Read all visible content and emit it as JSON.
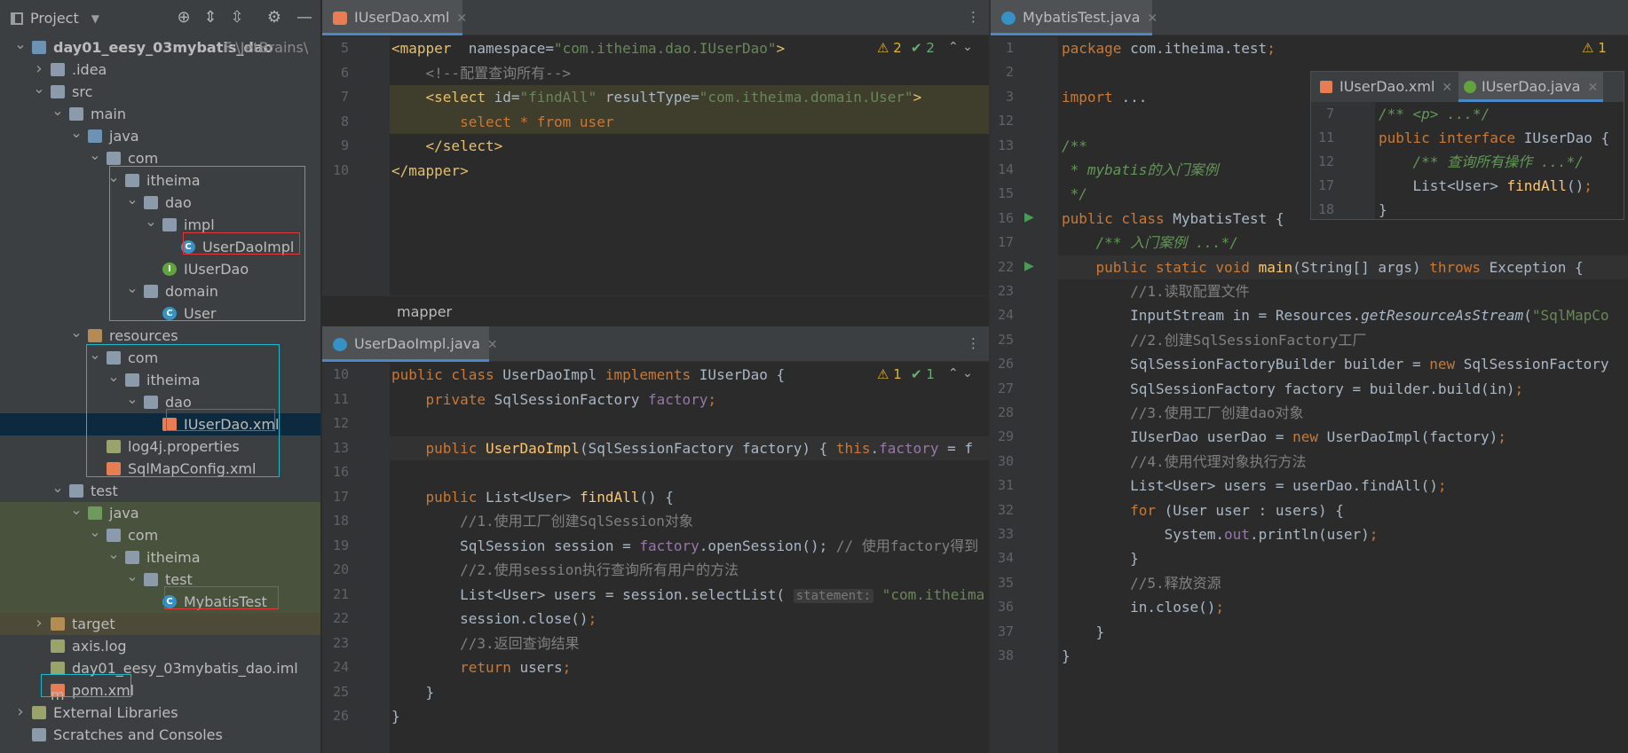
{
  "project_panel": {
    "title": "Project",
    "tree": [
      {
        "label": "day01_eesy_03mybatis_dao",
        "path": "F:\\JetBrains\\"
      },
      {
        "label": ".idea"
      },
      {
        "label": "src"
      },
      {
        "label": "main"
      },
      {
        "label": "java"
      },
      {
        "label": "com"
      },
      {
        "label": "itheima"
      },
      {
        "label": "dao"
      },
      {
        "label": "impl"
      },
      {
        "label": "UserDaoImpl"
      },
      {
        "label": "IUserDao"
      },
      {
        "label": "domain"
      },
      {
        "label": "User"
      },
      {
        "label": "resources"
      },
      {
        "label": "com"
      },
      {
        "label": "itheima"
      },
      {
        "label": "dao"
      },
      {
        "label": "IUserDao.xml"
      },
      {
        "label": "log4j.properties"
      },
      {
        "label": "SqlMapConfig.xml"
      },
      {
        "label": "test"
      },
      {
        "label": "java"
      },
      {
        "label": "com"
      },
      {
        "label": "itheima"
      },
      {
        "label": "test"
      },
      {
        "label": "MybatisTest"
      },
      {
        "label": "target"
      },
      {
        "label": "axis.log"
      },
      {
        "label": "day01_eesy_03mybatis_dao.iml"
      },
      {
        "label": "pom.xml"
      },
      {
        "label": "External Libraries"
      },
      {
        "label": "Scratches and Consoles"
      }
    ]
  },
  "editor_xml": {
    "tab": "IUserDao.xml",
    "breadcrumb": "mapper",
    "warnings": "2",
    "checks": "2",
    "lines": [
      {
        "n": "5",
        "segs": [
          [
            "tg",
            "<mapper"
          ],
          [
            "",
            "  namespace="
          ],
          [
            "str",
            "\"com.itheima.dao.IUserDao\""
          ],
          [
            "tg",
            ">"
          ]
        ]
      },
      {
        "n": "6",
        "segs": [
          [
            "cm",
            "    <!--配置查询所有-->"
          ]
        ]
      },
      {
        "n": "7",
        "segs": [
          [
            "tg",
            "    <select"
          ],
          [
            "",
            " id="
          ],
          [
            "str",
            "\"findAll\""
          ],
          [
            "",
            " resultType="
          ],
          [
            "str",
            "\"com.itheima.domain.User\""
          ],
          [
            "tg",
            ">"
          ]
        ]
      },
      {
        "n": "8",
        "segs": [
          [
            "kw",
            "        select * from user"
          ]
        ]
      },
      {
        "n": "9",
        "segs": [
          [
            "tg",
            "    </select>"
          ]
        ]
      },
      {
        "n": "10",
        "segs": [
          [
            "tg",
            "</mapper>"
          ]
        ]
      }
    ]
  },
  "editor_impl": {
    "tab": "UserDaoImpl.java",
    "warnings": "1",
    "checks": "1",
    "lines": [
      {
        "n": "10",
        "segs": [
          [
            "kw",
            "public class "
          ],
          [
            "",
            "UserDaoImpl "
          ],
          [
            "kw",
            "implements "
          ],
          [
            "",
            "IUserDao {"
          ]
        ]
      },
      {
        "n": "11",
        "segs": [
          [
            "kw",
            "    private "
          ],
          [
            "",
            "SqlSessionFactory "
          ],
          [
            "fld",
            "factory"
          ],
          [
            "kw",
            ";"
          ]
        ]
      },
      {
        "n": "12",
        "segs": [
          [
            "",
            ""
          ]
        ]
      },
      {
        "n": "13",
        "segs": [
          [
            "kw",
            "    public "
          ],
          [
            "fn",
            "UserDaoImpl"
          ],
          [
            "",
            "(SqlSessionFactory factory) { "
          ],
          [
            "kw",
            "this"
          ],
          [
            "",
            "."
          ],
          [
            "fld",
            "factory"
          ],
          [
            "",
            " = f"
          ]
        ]
      },
      {
        "n": "16",
        "segs": [
          [
            "",
            ""
          ]
        ]
      },
      {
        "n": "17",
        "segs": [
          [
            "kw",
            "    public "
          ],
          [
            "",
            "List<User> "
          ],
          [
            "fn",
            "findAll"
          ],
          [
            "",
            "() {"
          ]
        ]
      },
      {
        "n": "18",
        "segs": [
          [
            "cm",
            "        //1.使用工厂创建SqlSession对象"
          ]
        ]
      },
      {
        "n": "19",
        "segs": [
          [
            "",
            "        SqlSession session = "
          ],
          [
            "fld",
            "factory"
          ],
          [
            "",
            ".openSession(); "
          ],
          [
            "cm",
            "// 使用factory得到"
          ]
        ]
      },
      {
        "n": "20",
        "segs": [
          [
            "cm",
            "        //2.使用session执行查询所有用户的方法"
          ]
        ]
      },
      {
        "n": "21",
        "segs": [
          [
            "",
            "        List<User> users = session.selectList( "
          ],
          [
            "hint",
            "statement:"
          ],
          [
            "str",
            " \"com.itheima"
          ]
        ]
      },
      {
        "n": "22",
        "segs": [
          [
            "",
            "        session.close()"
          ],
          [
            "kw",
            ";"
          ]
        ]
      },
      {
        "n": "23",
        "segs": [
          [
            "cm",
            "        //3.返回查询结果"
          ]
        ]
      },
      {
        "n": "24",
        "segs": [
          [
            "kw",
            "        return "
          ],
          [
            "",
            "users"
          ],
          [
            "kw",
            ";"
          ]
        ]
      },
      {
        "n": "25",
        "segs": [
          [
            "",
            "    }"
          ]
        ]
      },
      {
        "n": "26",
        "segs": [
          [
            "",
            "}"
          ]
        ]
      }
    ]
  },
  "editor_test": {
    "tab": "MybatisTest.java",
    "warnings": "1",
    "lines": [
      {
        "n": "1",
        "segs": [
          [
            "kw",
            "package "
          ],
          [
            "",
            "com.itheima.test"
          ],
          [
            "kw",
            ";"
          ]
        ]
      },
      {
        "n": "2",
        "segs": [
          [
            "",
            ""
          ]
        ]
      },
      {
        "n": "3",
        "segs": [
          [
            "kw",
            "import "
          ],
          [
            "",
            "..."
          ]
        ]
      },
      {
        "n": "12",
        "segs": [
          [
            "",
            ""
          ]
        ]
      },
      {
        "n": "13",
        "segs": [
          [
            "doc",
            "/**"
          ]
        ]
      },
      {
        "n": "14",
        "segs": [
          [
            "doc",
            " * mybatis的入门案例"
          ]
        ]
      },
      {
        "n": "15",
        "segs": [
          [
            "doc",
            " */"
          ]
        ]
      },
      {
        "n": "16",
        "segs": [
          [
            "kw",
            "public class "
          ],
          [
            "",
            "MybatisTest {"
          ]
        ]
      },
      {
        "n": "17",
        "segs": [
          [
            "doc",
            "    /** 入门案例 ...*/"
          ]
        ]
      },
      {
        "n": "22",
        "segs": [
          [
            "kw",
            "    public static void "
          ],
          [
            "fn",
            "main"
          ],
          [
            "",
            "(String[] args) "
          ],
          [
            "kw",
            "throws "
          ],
          [
            "",
            "Exception {"
          ]
        ]
      },
      {
        "n": "23",
        "segs": [
          [
            "cm",
            "        //1.读取配置文件"
          ]
        ]
      },
      {
        "n": "24",
        "segs": [
          [
            "",
            "        InputStream in = Resources."
          ],
          [
            "ital",
            "getResourceAsStream"
          ],
          [
            "",
            "("
          ],
          [
            "str",
            "\"SqlMapCo"
          ]
        ]
      },
      {
        "n": "25",
        "segs": [
          [
            "cm",
            "        //2.创建SqlSessionFactory工厂"
          ]
        ]
      },
      {
        "n": "26",
        "segs": [
          [
            "",
            "        SqlSessionFactoryBuilder builder = "
          ],
          [
            "kw",
            "new "
          ],
          [
            "",
            "SqlSessionFactory"
          ]
        ]
      },
      {
        "n": "27",
        "segs": [
          [
            "",
            "        SqlSessionFactory factory = builder.build(in)"
          ],
          [
            "kw",
            ";"
          ]
        ]
      },
      {
        "n": "28",
        "segs": [
          [
            "cm",
            "        //3.使用工厂创建dao对象"
          ]
        ]
      },
      {
        "n": "29",
        "segs": [
          [
            "",
            "        IUserDao userDao = "
          ],
          [
            "kw",
            "new "
          ],
          [
            "",
            "UserDaoImpl(factory)"
          ],
          [
            "kw",
            ";"
          ]
        ]
      },
      {
        "n": "30",
        "segs": [
          [
            "cm",
            "        //4.使用代理对象执行方法"
          ]
        ]
      },
      {
        "n": "31",
        "segs": [
          [
            "",
            "        List<User> users = userDao.findAll()"
          ],
          [
            "kw",
            ";"
          ]
        ]
      },
      {
        "n": "32",
        "segs": [
          [
            "kw",
            "        for "
          ],
          [
            "",
            "(User user : users) {"
          ]
        ]
      },
      {
        "n": "33",
        "segs": [
          [
            "",
            "            System."
          ],
          [
            "fld",
            "out"
          ],
          [
            "",
            ".println(user)"
          ],
          [
            "kw",
            ";"
          ]
        ]
      },
      {
        "n": "34",
        "segs": [
          [
            "",
            "        }"
          ]
        ]
      },
      {
        "n": "35",
        "segs": [
          [
            "cm",
            "        //5.释放资源"
          ]
        ]
      },
      {
        "n": "36",
        "segs": [
          [
            "",
            "        in.close()"
          ],
          [
            "kw",
            ";"
          ]
        ]
      },
      {
        "n": "37",
        "segs": [
          [
            "",
            "    }"
          ]
        ]
      },
      {
        "n": "38",
        "segs": [
          [
            "",
            "}"
          ]
        ]
      }
    ]
  },
  "popup": {
    "tabs": [
      "IUserDao.xml",
      "IUserDao.java"
    ],
    "lines": [
      {
        "n": "7",
        "segs": [
          [
            "doc",
            "/** <p> ...*/"
          ]
        ]
      },
      {
        "n": "11",
        "segs": [
          [
            "kw",
            "public interface "
          ],
          [
            "",
            "IUserDao {"
          ]
        ]
      },
      {
        "n": "12",
        "segs": [
          [
            "doc",
            "    /** 查询所有操作 ...*/"
          ]
        ]
      },
      {
        "n": "17",
        "segs": [
          [
            "",
            "    List<User> "
          ],
          [
            "fn",
            "findAll"
          ],
          [
            "",
            "()"
          ],
          [
            "kw",
            ";"
          ]
        ]
      },
      {
        "n": "18",
        "segs": [
          [
            "",
            "}"
          ]
        ]
      }
    ]
  }
}
